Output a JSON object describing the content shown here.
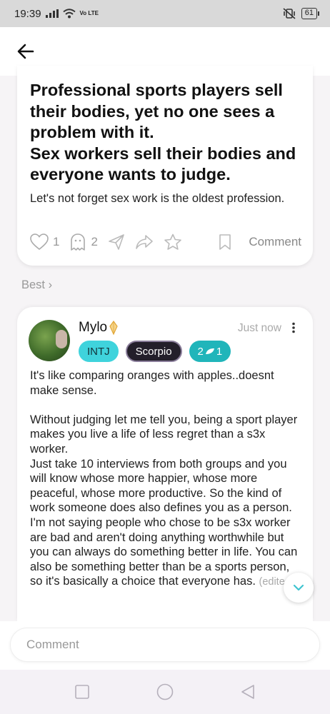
{
  "status_bar": {
    "time": "19:39",
    "network": "Vo LTE",
    "battery": "61"
  },
  "post": {
    "title": "Professional sports players sell their bodies, yet no one sees a problem with it.\nSex workers sell their bodies and everyone wants to judge.",
    "body": "Let's not forget sex work is the oldest profession.",
    "like_count": "1",
    "ghost_count": "2",
    "comment_label": "Comment"
  },
  "sort": {
    "label": "Best ›"
  },
  "comment": {
    "username": "Mylo",
    "timestamp": "Just now",
    "tags": {
      "mbti": "INTJ",
      "zodiac": "Scorpio",
      "level_a": "2",
      "level_b": "1"
    },
    "text": "It's like comparing oranges with apples..doesnt make sense.\n\nWithout judging let me tell you, being a sport player makes you live a life of less regret than a s3x worker.\nJust take 10 interviews from both groups and you will know whose more happier, whose more peaceful, whose more productive. So the kind of work someone does also defines you as a person.\nI'm not saying people who chose to be s3x worker are bad and aren't doing anything worthwhile but you can always do something better in life. You can also be something better than be a sports person, so it's basically a choice that everyone has.",
    "edited_label": "(edited)"
  },
  "comment_bar": {
    "placeholder": "Comment"
  },
  "colors": {
    "mbti_tag": "#3fd3dc",
    "zodiac_tag": "#231f2a",
    "level_tag": "#20b5ba",
    "muted_text": "#999999"
  },
  "icons": {
    "back": "arrow-left-icon",
    "like": "heart-icon",
    "ghost": "ghost-icon",
    "send": "paper-plane-icon",
    "share": "share-arrow-icon",
    "favorite": "star-icon",
    "bookmark": "bookmark-icon",
    "more": "more-vertical-icon",
    "badge": "gold-badge-icon",
    "scroll_down": "chevron-down-icon",
    "nav_recent": "square-icon",
    "nav_home": "circle-icon",
    "nav_back": "triangle-back-icon"
  }
}
